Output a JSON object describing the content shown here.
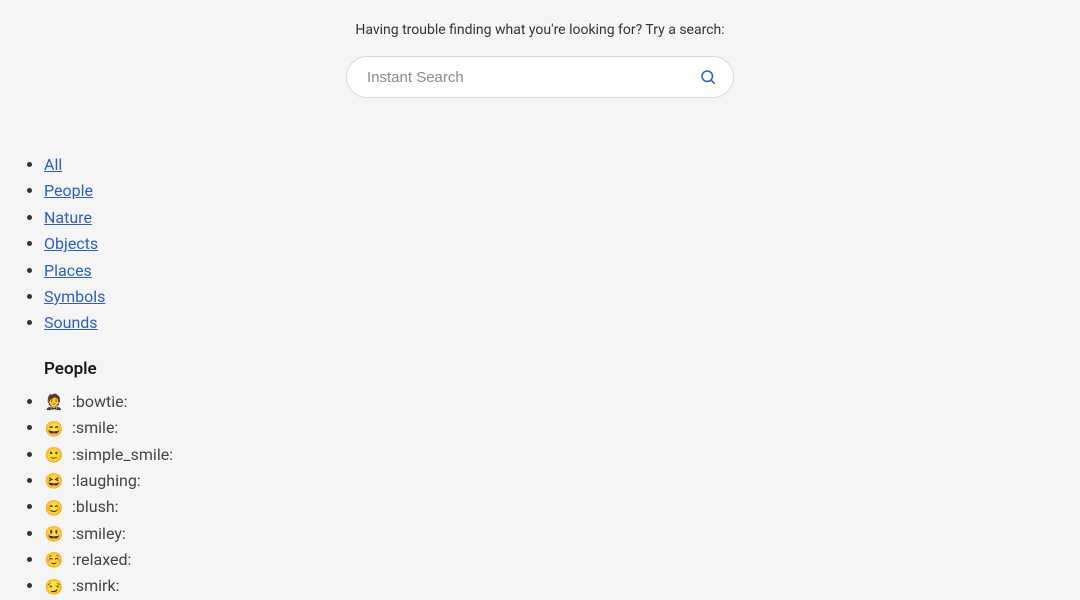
{
  "search": {
    "prompt": "Having trouble finding what you're looking for? Try a search:",
    "placeholder": "Instant Search"
  },
  "nav": {
    "items": [
      {
        "label": "All"
      },
      {
        "label": "People"
      },
      {
        "label": "Nature"
      },
      {
        "label": "Objects"
      },
      {
        "label": "Places"
      },
      {
        "label": "Symbols"
      },
      {
        "label": "Sounds"
      }
    ]
  },
  "section": {
    "title": "People",
    "emojis": [
      {
        "glyph": "🤵",
        "code": ":bowtie:"
      },
      {
        "glyph": "😄",
        "code": ":smile:"
      },
      {
        "glyph": "🙂",
        "code": ":simple_smile:"
      },
      {
        "glyph": "😆",
        "code": ":laughing:"
      },
      {
        "glyph": "😊",
        "code": ":blush:"
      },
      {
        "glyph": "😃",
        "code": ":smiley:"
      },
      {
        "glyph": "☺️",
        "code": ":relaxed:"
      },
      {
        "glyph": "😏",
        "code": ":smirk:"
      }
    ]
  }
}
